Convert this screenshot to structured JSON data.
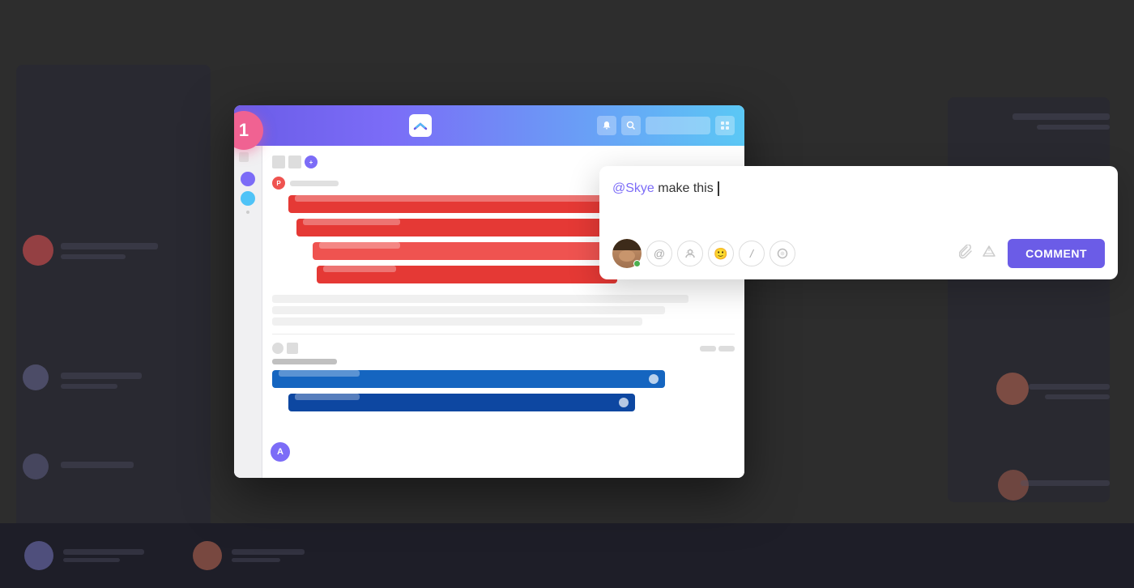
{
  "background": {
    "color": "#2d2d2d"
  },
  "notification_badge": {
    "number": "1"
  },
  "window": {
    "header": {
      "logo_alt": "ClickUp logo"
    },
    "sidebar": {
      "dots": [
        "#7c6cf7",
        "#4fc3f7"
      ]
    }
  },
  "comment_popup": {
    "mention": "@Skye",
    "text": " make this ",
    "placeholder": "",
    "toolbar_icons": [
      "@",
      "↕",
      "😊",
      "/",
      "◎"
    ],
    "comment_button_label": "COMMENT"
  },
  "avatar": {
    "initials": "A"
  }
}
